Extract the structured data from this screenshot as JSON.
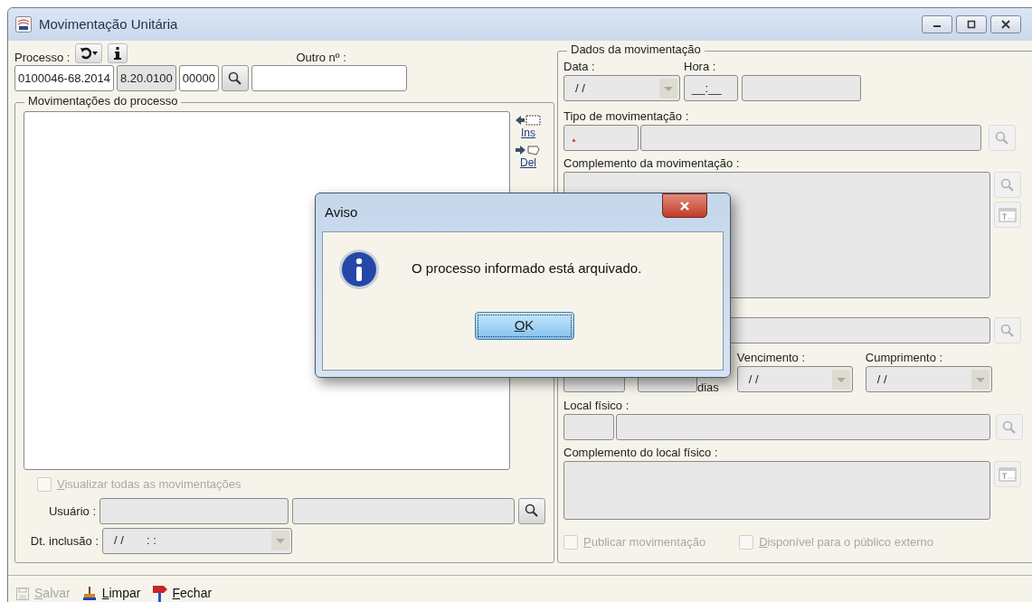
{
  "window": {
    "title": "Movimentação Unitária"
  },
  "process": {
    "label": "Processo :",
    "other_label": "Outro nº :",
    "number_parts": [
      {
        "value": "0100046-68.2014",
        "disabled": false
      },
      {
        "value": "8.20.0100",
        "disabled": true
      },
      {
        "value": "00000",
        "disabled": false
      }
    ]
  },
  "movements": {
    "title": "Movimentações do processo",
    "side_buttons": [
      {
        "label": "Ins",
        "kind": "insert"
      },
      {
        "label": "Del",
        "kind": "delete"
      }
    ]
  },
  "show_all": {
    "label": "Visualizar todas as movimentações",
    "checked": false,
    "disabled": true
  },
  "user": {
    "label": "Usuário :"
  },
  "included": {
    "label": "Dt. inclusão :",
    "value": "/ /       : :"
  },
  "details": {
    "title": "Dados da movimentação",
    "date_label": "Data :",
    "date_value": "/ /",
    "time_label": "Hora :",
    "time_value": "__:__",
    "type_label": "Tipo de movimentação :",
    "complement_label": "Complemento da movimentação :",
    "days_label": "dias",
    "due_label": "Vencimento :",
    "due_value": "/ /",
    "done_label": "Cumprimento :",
    "done_value": "/ /",
    "location_label": "Local físico :",
    "location_complement_label": "Complemento do local físico :",
    "checkboxes": [
      {
        "label": "Publicar movimentação",
        "checked": false,
        "disabled": true
      },
      {
        "label": "Disponível para o público externo",
        "checked": false,
        "disabled": true
      }
    ]
  },
  "toolbar": [
    {
      "label": "Salvar",
      "kind": "save",
      "disabled": true
    },
    {
      "label": "Limpar",
      "kind": "clear",
      "disabled": false
    },
    {
      "label": "Fechar",
      "kind": "close",
      "disabled": false
    }
  ],
  "dialog": {
    "title": "Aviso",
    "message": "O processo informado está arquivado.",
    "button": "OK"
  }
}
